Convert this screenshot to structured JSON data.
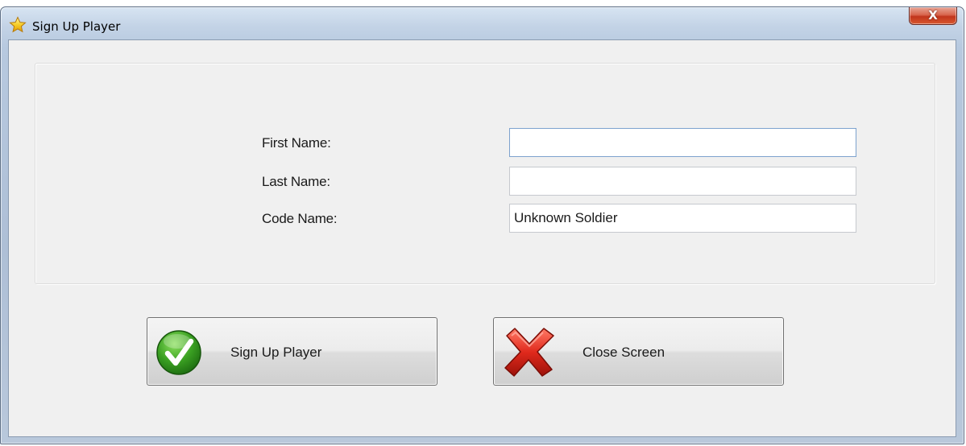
{
  "window": {
    "title": "Sign Up Player",
    "close_glyph": "X",
    "title_icon": "star-icon"
  },
  "form": {
    "fields": [
      {
        "label": "First Name:",
        "value": ""
      },
      {
        "label": "Last Name:",
        "value": ""
      },
      {
        "label": "Code Name:",
        "value": "Unknown Soldier"
      }
    ]
  },
  "buttons": {
    "sign_up": {
      "label": "Sign Up Player",
      "icon": "green-checkmark-icon"
    },
    "close": {
      "label": "Close Screen",
      "icon": "red-x-icon"
    }
  },
  "colors": {
    "client_bg": "#f0f0f0",
    "check_green": "#3aa022",
    "x_red": "#d6261b"
  }
}
